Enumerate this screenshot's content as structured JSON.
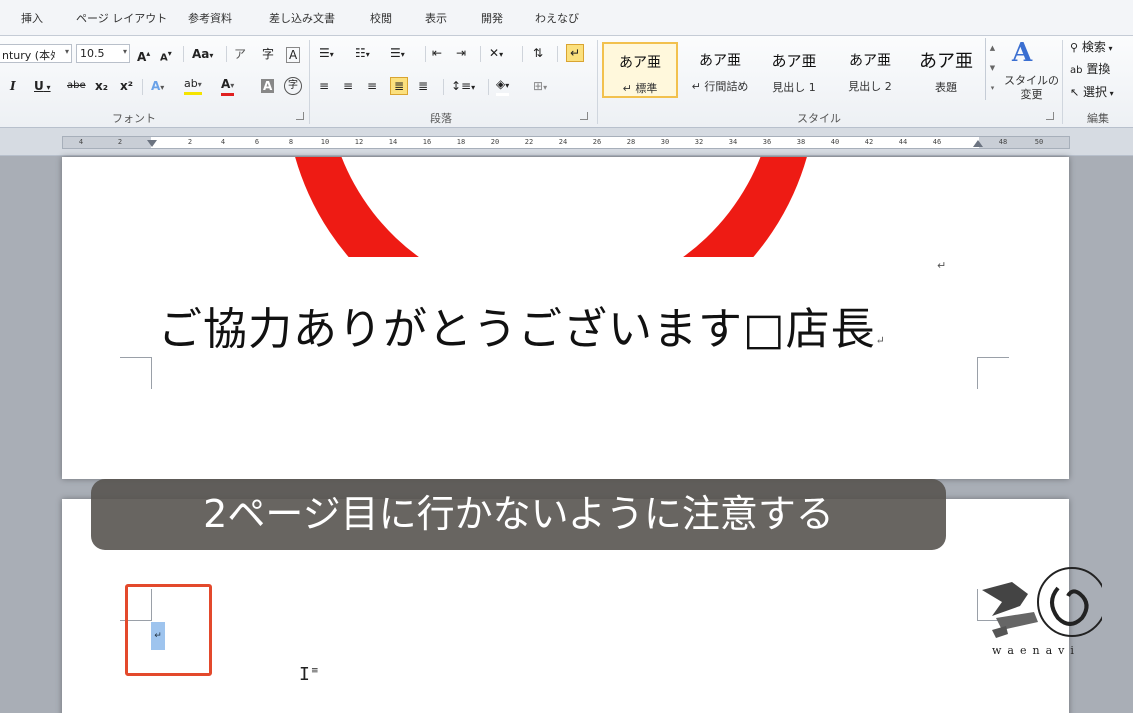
{
  "ribbon_tabs": [
    "挿入",
    "ページ レイアウト",
    "参考資料",
    "差し込み文書",
    "校閲",
    "表示",
    "開発",
    "わえなび"
  ],
  "font_group": {
    "font_name": "ntury (本ﾀ",
    "font_size": "10.5",
    "grow": "A",
    "shrink": "A",
    "change_case": "Aa",
    "phonetic": "ア",
    "enclose": "字",
    "border_char": "A",
    "italic": "I",
    "underline": "U",
    "strike": "abe",
    "subscript": "x₂",
    "superscript": "x²",
    "effects": "A",
    "highlight": "ab",
    "font_color": "A",
    "shading": "A",
    "enclosed_char": "字",
    "label": "フォント"
  },
  "paragraph_group": {
    "label": "段落"
  },
  "styles_group": {
    "label": "スタイル",
    "items": [
      {
        "sample": "あア亜",
        "name": "↵ 標準"
      },
      {
        "sample": "あア亜",
        "name": "↵ 行間詰め"
      },
      {
        "sample": "あア亜",
        "name": "見出し 1"
      },
      {
        "sample": "あア亜",
        "name": "見出し 2"
      },
      {
        "sample": "あア亜",
        "name": "表題"
      }
    ],
    "change_styles": "スタイルの\n変更"
  },
  "edit_group": {
    "label": "編集",
    "find": "検索",
    "replace": "置換",
    "select": "選択"
  },
  "ruler_ticks": [
    "4",
    "2",
    "2",
    "4",
    "6",
    "8",
    "10",
    "12",
    "14",
    "16",
    "18",
    "20",
    "22",
    "24",
    "26",
    "28",
    "30",
    "32",
    "34",
    "36",
    "38",
    "40",
    "42",
    "44",
    "46",
    "48",
    "50"
  ],
  "document": {
    "greeting": "ご協力ありがとうございます□店長",
    "para_mark": "↵"
  },
  "caption": "2ページ目に行かないように注意する",
  "logo_text": "waenavi",
  "colors": {
    "ring": "#ee1b14",
    "highlight_box": "#e3492c",
    "caption_bg": "#58544f"
  }
}
